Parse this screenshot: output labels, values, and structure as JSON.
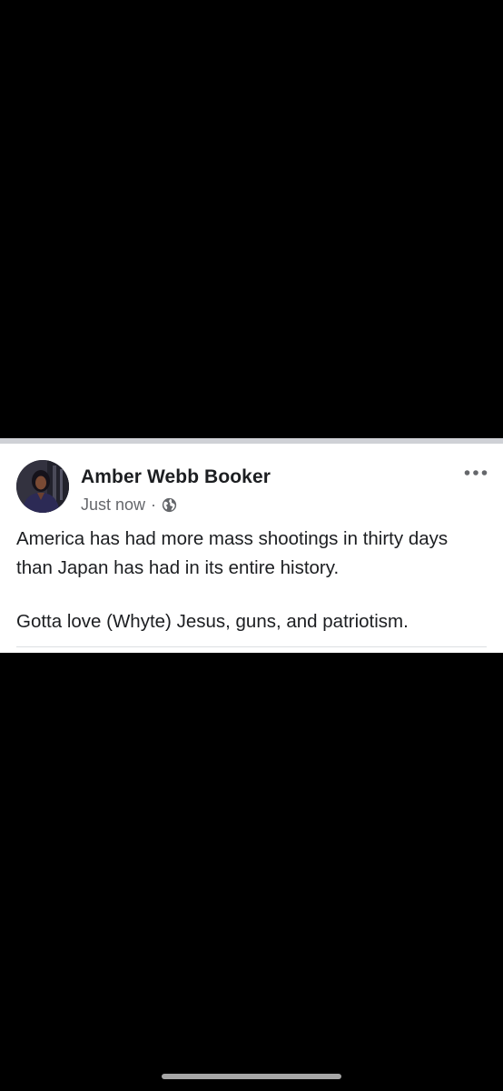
{
  "post": {
    "author_name": "Amber Webb Booker",
    "timestamp": "Just now",
    "separator": "·",
    "privacy_icon": "globe-icon",
    "more_icon": "more-options-icon",
    "text_paragraphs": [
      "America has had more mass shootings in thirty days than Japan has had in its entire history.",
      "Gotta love (Whyte) Jesus, guns, and patriotism."
    ]
  },
  "colors": {
    "background": "#000000",
    "card": "#ffffff",
    "text_primary": "#1c1e21",
    "text_secondary": "#65676b",
    "home_indicator": "#a6a6a6"
  }
}
